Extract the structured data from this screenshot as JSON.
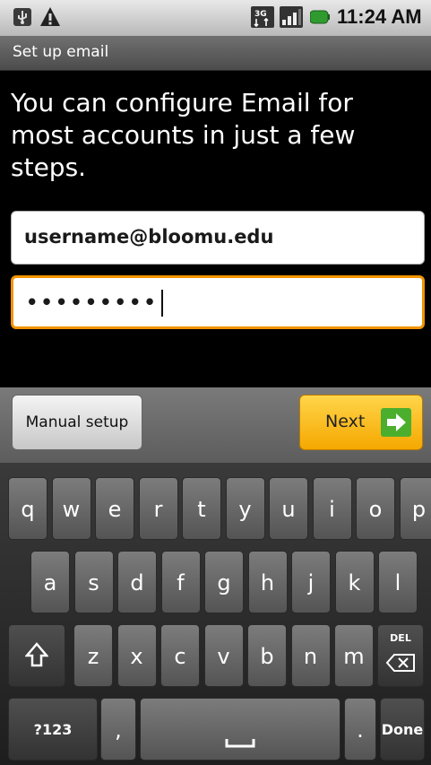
{
  "status_bar": {
    "time": "11:24 AM"
  },
  "title_bar": {
    "title": "Set up email"
  },
  "intro_text": "You can configure Email for most accounts in just a few steps.",
  "form": {
    "email_value": "username@bloomu.edu",
    "password_value": "•••••••••"
  },
  "buttons": {
    "manual_setup": "Manual setup",
    "next": "Next"
  },
  "keyboard": {
    "row1": [
      "q",
      "w",
      "e",
      "r",
      "t",
      "y",
      "u",
      "i",
      "o",
      "p"
    ],
    "row2": [
      "a",
      "s",
      "d",
      "f",
      "g",
      "h",
      "j",
      "k",
      "l"
    ],
    "row3": [
      "z",
      "x",
      "c",
      "v",
      "b",
      "n",
      "m"
    ],
    "del_label": "DEL",
    "symbols": "?123",
    "comma": ",",
    "period": ".",
    "done": "Done"
  },
  "colors": {
    "accent_orange": "#f29400",
    "next_yellow": "#ffc425",
    "arrow_green": "#4cae2d"
  }
}
